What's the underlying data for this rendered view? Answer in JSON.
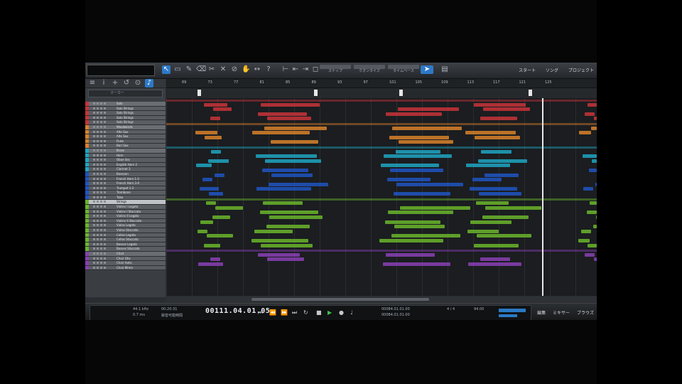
{
  "toolbar": {
    "tools": [
      "↖",
      "▭",
      "✎",
      "⌫",
      "✂",
      "✕",
      "⊘",
      "✋",
      "↔",
      "◀",
      "?",
      "⊢",
      "⇤",
      "⇥",
      "◻",
      "➤",
      "▤"
    ],
    "groups": [
      {
        "label": "スナップ"
      },
      {
        "label": "クオンタイズ"
      },
      {
        "label": "タイムベース"
      }
    ],
    "pages": [
      "スタート",
      "ソング",
      "プロジェクト"
    ]
  },
  "left_panel": {
    "tools": [
      "≡",
      "i",
      "+",
      "↺",
      "⊙",
      "♪"
    ],
    "search_label": "マーカー",
    "tracks": [
      {
        "name": "Solo",
        "color": "#c7343a",
        "folder": true
      },
      {
        "name": "Solo Strings",
        "color": "#c7343a"
      },
      {
        "name": "Solo Strings",
        "color": "#c7343a"
      },
      {
        "name": "Solo Strings",
        "color": "#c7343a"
      },
      {
        "name": "Solo Strings",
        "color": "#c7343a"
      },
      {
        "name": "Woodwinds",
        "color": "#d8812a",
        "folder": true
      },
      {
        "name": "Alto Sax",
        "color": "#d8812a"
      },
      {
        "name": "Alto Sax",
        "color": "#d8812a"
      },
      {
        "name": "Flute",
        "color": "#d8812a"
      },
      {
        "name": "Bari Sax",
        "color": "#d8812a"
      },
      {
        "name": "Brass",
        "color": "#1ea5c2",
        "folder": true
      },
      {
        "name": "Horn",
        "color": "#1ea5c2"
      },
      {
        "name": "Oboe Sec",
        "color": "#1ea5c2"
      },
      {
        "name": "English Horn 2",
        "color": "#1ea5c2"
      },
      {
        "name": "Clarinet 3",
        "color": "#1ea5c2"
      },
      {
        "name": "Bassoon",
        "color": "#1e55c2"
      },
      {
        "name": "French Horn 1-2",
        "color": "#1e55c2"
      },
      {
        "name": "French Horn 3-4",
        "color": "#1e55c2"
      },
      {
        "name": "Trumpet 1-2",
        "color": "#1e55c2"
      },
      {
        "name": "Trombone",
        "color": "#1e55c2"
      },
      {
        "name": "Tuba",
        "color": "#1e55c2"
      },
      {
        "name": "Strings",
        "color": "#6ab52c",
        "folder": true,
        "selected": true
      },
      {
        "name": "Violins I Legato",
        "color": "#6ab52c"
      },
      {
        "name": "Violins I Staccato",
        "color": "#6ab52c"
      },
      {
        "name": "Violins II Legato",
        "color": "#6ab52c"
      },
      {
        "name": "Violins II Staccato",
        "color": "#6ab52c"
      },
      {
        "name": "Violas Legato",
        "color": "#6ab52c"
      },
      {
        "name": "Violas Staccato",
        "color": "#6ab52c"
      },
      {
        "name": "Cellos Legato",
        "color": "#6ab52c"
      },
      {
        "name": "Cellos Staccato",
        "color": "#6ab52c"
      },
      {
        "name": "Basses Legato",
        "color": "#6ab52c"
      },
      {
        "name": "Basses Staccato",
        "color": "#6ab52c"
      },
      {
        "name": "Choir",
        "color": "#8a3fb5",
        "folder": true
      },
      {
        "name": "Choir Ohs",
        "color": "#8a3fb5"
      },
      {
        "name": "Choir Aahs",
        "color": "#8a3fb5"
      },
      {
        "name": "Choir Mmm",
        "color": "#8a3fb5"
      }
    ]
  },
  "ruler": {
    "bars": [
      "69",
      "73",
      "77",
      "81",
      "85",
      "89",
      "93",
      "97",
      "101",
      "105",
      "109",
      "113",
      "117",
      "121",
      "125"
    ]
  },
  "transport": {
    "sample_rate": "44.1 kHz",
    "latency": "0.7 ms",
    "time": "00:20:31",
    "record_label": "録音可能時間",
    "position": "00111.04.01.05",
    "loop_start": "00084.01.01.00",
    "loop_end": "00084.01.01.00",
    "signature": "4 / 4",
    "tempo": "94.00",
    "buttons": [
      "編集",
      "ミキサー",
      "ブラウズ"
    ]
  }
}
